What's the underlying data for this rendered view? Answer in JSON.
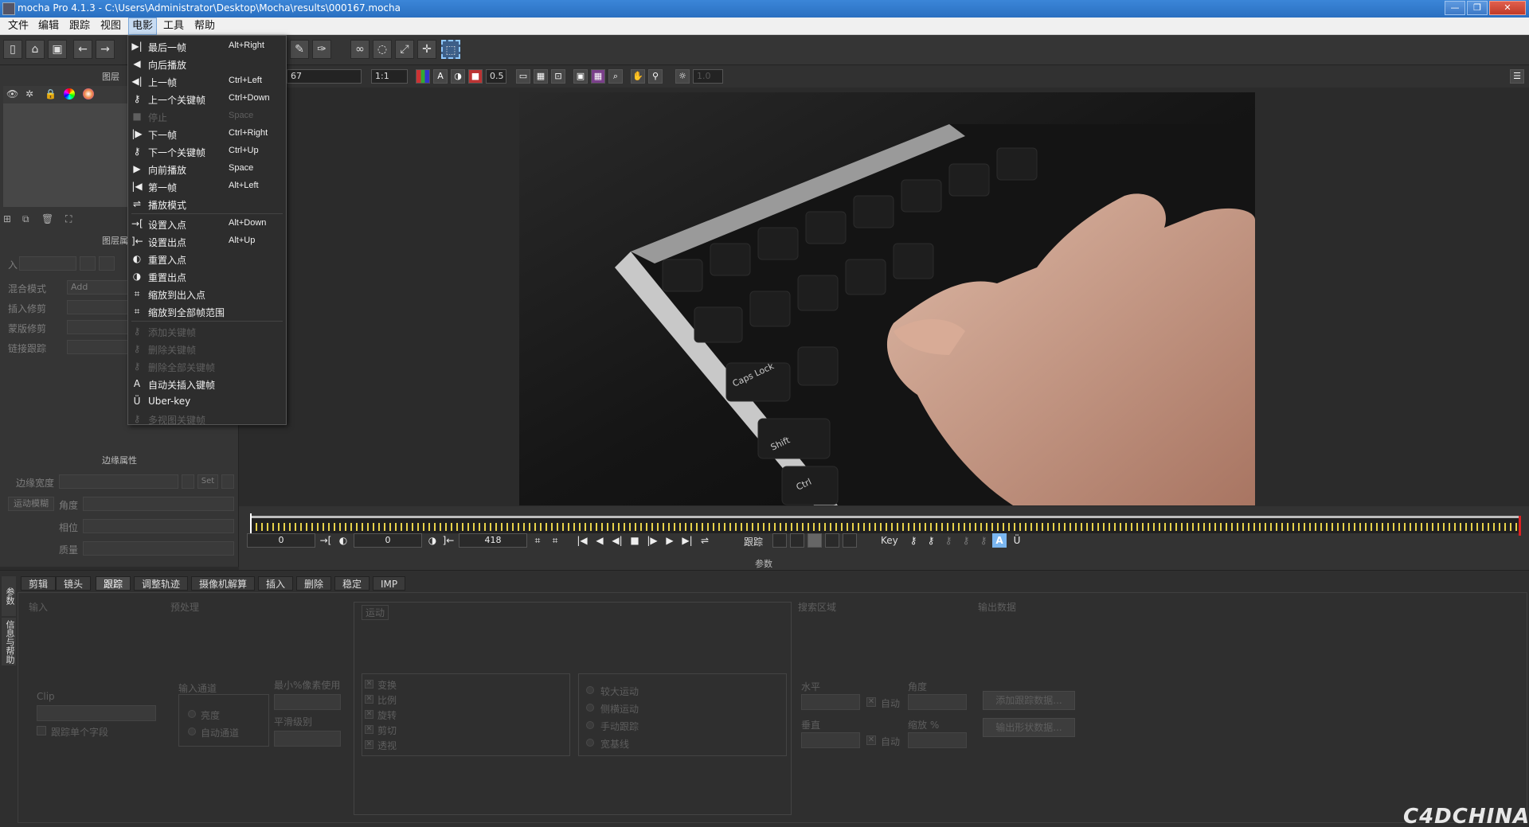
{
  "window": {
    "title": "mocha Pro 4.1.3 - C:\\Users\\Administrator\\Desktop\\Mocha\\results\\000167.mocha",
    "min": "—",
    "max": "❐",
    "close": "✕"
  },
  "menubar": [
    "文件",
    "编辑",
    "跟踪",
    "视图",
    "电影",
    "工具",
    "帮助"
  ],
  "dropdown": [
    {
      "icon": "▶|",
      "label": "最后一帧",
      "shortcut": "Alt+Right",
      "enabled": true
    },
    {
      "icon": "◀",
      "label": "向后播放",
      "shortcut": "",
      "enabled": true
    },
    {
      "icon": "◀|",
      "label": "上一帧",
      "shortcut": "Ctrl+Left",
      "enabled": true
    },
    {
      "icon": "⚷",
      "label": "上一个关键帧",
      "shortcut": "Ctrl+Down",
      "enabled": true
    },
    {
      "icon": "■",
      "label": "停止",
      "shortcut": "Space",
      "enabled": false
    },
    {
      "icon": "|▶",
      "label": "下一帧",
      "shortcut": "Ctrl+Right",
      "enabled": true
    },
    {
      "icon": "⚷",
      "label": "下一个关键帧",
      "shortcut": "Ctrl+Up",
      "enabled": true
    },
    {
      "icon": "▶",
      "label": "向前播放",
      "shortcut": "Space",
      "enabled": true
    },
    {
      "icon": "|◀",
      "label": "第一帧",
      "shortcut": "Alt+Left",
      "enabled": true
    },
    {
      "icon": "⇌",
      "label": "播放模式",
      "shortcut": "",
      "enabled": true
    },
    {
      "icon": "→[",
      "label": "设置入点",
      "shortcut": "Alt+Down",
      "enabled": true
    },
    {
      "icon": "]←",
      "label": "设置出点",
      "shortcut": "Alt+Up",
      "enabled": true
    },
    {
      "icon": "◐",
      "label": "重置入点",
      "shortcut": "",
      "enabled": true
    },
    {
      "icon": "◑",
      "label": "重置出点",
      "shortcut": "",
      "enabled": true
    },
    {
      "icon": "⌗",
      "label": "缩放到出入点",
      "shortcut": "",
      "enabled": true
    },
    {
      "icon": "⌗",
      "label": "缩放到全部帧范围",
      "shortcut": "",
      "enabled": true
    },
    {
      "icon": "⚷",
      "label": "添加关键帧",
      "shortcut": "",
      "enabled": false
    },
    {
      "icon": "⚷",
      "label": "删除关键帧",
      "shortcut": "",
      "enabled": false
    },
    {
      "icon": "⚷",
      "label": "删除全部关键帧",
      "shortcut": "",
      "enabled": false
    },
    {
      "icon": "A",
      "label": "自动关插入键帧",
      "shortcut": "",
      "enabled": true
    },
    {
      "icon": "Ü",
      "label": "Uber-key",
      "shortcut": "",
      "enabled": true
    },
    {
      "icon": "⚷",
      "label": "多视图关键帧",
      "shortcut": "",
      "enabled": false
    }
  ],
  "viewbar": {
    "frame": "67",
    "zoom": "1:1",
    "opacity": "0.5",
    "extra": "1.0"
  },
  "left_panel": {
    "layers_title": "图层",
    "layer_props_title": "图层属性",
    "in_label": "入",
    "blend_mode_label": "混合模式",
    "blend_mode_value": "Add",
    "insert_clip_label": "插入修剪",
    "matte_clip_label": "蒙版修剪",
    "link_track_label": "链接跟踪",
    "edge_props_title": "边缘属性",
    "edge_width_label": "边缘宽度",
    "edge_width_unit": "Set",
    "motion_blur_label": "运动模糊",
    "angle_label": "角度",
    "phase_label": "相位",
    "quality_label": "质量"
  },
  "timeline": {
    "in_value": "0",
    "mid_value": "0",
    "out_value": "418",
    "track_label": "跟踪",
    "key_label": "Key",
    "params_label": "参数"
  },
  "tabs": [
    "剪辑",
    "镜头",
    "跟踪",
    "调整轨迹",
    "摄像机解算",
    "插入",
    "删除",
    "稳定",
    "IMP"
  ],
  "active_tab": 2,
  "side_tabs": [
    "参数",
    "信息与帮助"
  ],
  "params": {
    "input_title": "输入",
    "preprocess_title": "预处理",
    "clip_label": "Clip",
    "track_single_field": "跟踪单个字段",
    "input_channel_title": "输入通道",
    "luminance": "亮度",
    "auto_channel": "自动通道",
    "min_pixels_label": "最小%像素使用",
    "smooth_label": "平滑级别",
    "motion_title": "运动",
    "motion_options": [
      "变换",
      "比例",
      "旋转",
      "剪切",
      "透视"
    ],
    "motion_types": [
      "较大运动",
      "侧横运动",
      "手动跟踪",
      "宽基线"
    ],
    "search_area_title": "搜索区域",
    "horizontal_label": "水平",
    "vertical_label": "垂直",
    "auto_label": "自动",
    "angle_label": "角度",
    "zoom_label": "缩放 %",
    "output_title": "输出数据",
    "add_tracking_btn": "添加跟踪数据...",
    "export_shape_btn": "输出形状数据..."
  },
  "watermark": "C4DCHINA"
}
